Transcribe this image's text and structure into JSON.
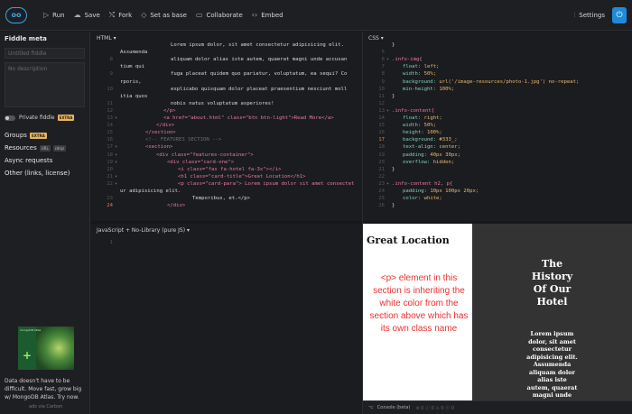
{
  "toolbar": {
    "logo": "oo",
    "run": "Run",
    "save": "Save",
    "fork": "Fork",
    "set_as_base": "Set as base",
    "collaborate": "Collaborate",
    "embed": "Embed",
    "settings": "Settings"
  },
  "sidebar": {
    "title": "Fiddle meta",
    "title_placeholder": "Untitled fiddle",
    "description_placeholder": "No description",
    "private_label": "Private fiddle",
    "extra_badge": "EXTRA",
    "groups": "Groups",
    "resources": "Resources",
    "resources_tag1": "URL",
    "resources_tag2": "cdnjs",
    "async": "Async requests",
    "other": "Other (links, license)",
    "ad_brand": "mongoDB Atlas",
    "ad_text": "Data doesn't have to be difficult. Move fast, grow big w/ MongoDB Atlas. Try now.",
    "ad_via": "ads via Carbon"
  },
  "html_panel": {
    "label": "HTML ▾",
    "lines": [
      {
        "n": "",
        "text": "Lorem ipsum dolor, sit amet consectetur adipisicing elit."
      },
      {
        "n": "",
        "text": "Assumenda"
      },
      {
        "n": "8",
        "text": "aliquam dolor alias iste autem, quaerat magni unde accusan"
      },
      {
        "n": "",
        "text": "tium qui"
      },
      {
        "n": "9",
        "text": "fuga placeat quidem quo pariatur, voluptatum, ea sequi? Co"
      },
      {
        "n": "",
        "text": "rporis,"
      },
      {
        "n": "10",
        "text": "explicabo quisquam dolor placeat praesentium nesciunt moll"
      },
      {
        "n": "",
        "text": "itia quos"
      },
      {
        "n": "11",
        "text": "nobis natus voluptatum asperiores!"
      },
      {
        "n": "12",
        "text": "</p>"
      },
      {
        "n": "13",
        "text": "<a href=\"about.html\" class=\"btn btn-light\">Read More</a>"
      },
      {
        "n": "14",
        "text": "</div>"
      },
      {
        "n": "15",
        "text": "</section>"
      },
      {
        "n": "16",
        "text": "<!-- FEATURES SECTION -->"
      },
      {
        "n": "17",
        "text": "<section>"
      },
      {
        "n": "18",
        "text": "<div class=\"features-container\">"
      },
      {
        "n": "19",
        "text": "<div class=\"card-one\">"
      },
      {
        "n": "20",
        "text": "<i class=\"fas fa-hotel fa-3x\"></i>"
      },
      {
        "n": "21",
        "text": "<h1 class=\"card-title\">Great Location</h1>"
      },
      {
        "n": "22",
        "text": "<p class=\"card-para\"> Lorem ipsum dolor sit amet consectet"
      },
      {
        "n": "",
        "text": "ur adipisicing elit."
      },
      {
        "n": "23",
        "text": "Temporibus, et.</p>"
      },
      {
        "n": "24",
        "text": "</div>"
      }
    ]
  },
  "css_panel": {
    "label": "CSS ▾",
    "lines": [
      {
        "n": "",
        "text": "}"
      },
      {
        "n": "5",
        "text": ""
      },
      {
        "n": "6",
        "text": ".info-img{"
      },
      {
        "n": "7",
        "text": "float: left;"
      },
      {
        "n": "8",
        "text": "width: 50%;"
      },
      {
        "n": "9",
        "text": "background: url('/image-resources/photo-1.jpg') no-repeat;"
      },
      {
        "n": "10",
        "text": "min-height: 100%;"
      },
      {
        "n": "11",
        "text": "}"
      },
      {
        "n": "12",
        "text": ""
      },
      {
        "n": "13",
        "text": ".info-content{"
      },
      {
        "n": "14",
        "text": "float: right;"
      },
      {
        "n": "15",
        "text": "width: 50%;"
      },
      {
        "n": "16",
        "text": "height: 100%;"
      },
      {
        "n": "17",
        "text": "background: #333_;"
      },
      {
        "n": "18",
        "text": "text-align: center;"
      },
      {
        "n": "19",
        "text": "padding: 40px 30px;"
      },
      {
        "n": "20",
        "text": "overflow: hidden;"
      },
      {
        "n": "21",
        "text": "}"
      },
      {
        "n": "22",
        "text": ""
      },
      {
        "n": "23",
        "text": ".info-content h2, p{"
      },
      {
        "n": "24",
        "text": "padding: 10px 100px 20px;"
      },
      {
        "n": "25",
        "text": "color: white;"
      },
      {
        "n": "26",
        "text": "}"
      }
    ]
  },
  "js_panel": {
    "label": "JavaScript + No-Library (pure JS) ▾",
    "first_line": "1"
  },
  "result": {
    "left_title": "Great Location",
    "left_red_text": "<p> element in this section is inheriting the white color from the section above which has its own class name",
    "right_title": "The History Of Our Hotel",
    "right_para": "Lorem ipsum dolor, sit amet consectetur adipisicing elit. Assumenda aliquam dolor alias iste autem, quaerat magni unde"
  },
  "console": {
    "label": "Console (beta)",
    "counts": "⊘ 0  ⓘ 0  ⚠ 0  ⓧ 0"
  },
  "colors": {
    "accent": "#1e8bd8",
    "badge": "#e9b45a",
    "red_text": "#ee2f2f",
    "result_dark": "#333333"
  }
}
